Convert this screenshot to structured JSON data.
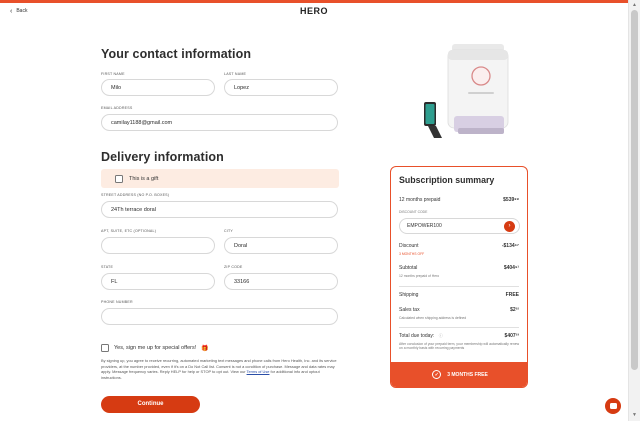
{
  "header": {
    "back_label": "Back",
    "logo": "HERO"
  },
  "contact": {
    "title": "Your contact information",
    "first_name_label": "FIRST NAME",
    "first_name_value": "Milo",
    "last_name_label": "LAST NAME",
    "last_name_value": "Lopez",
    "email_label": "EMAIL ADDRESS",
    "email_value": "camilay1188@gmail.com"
  },
  "delivery": {
    "title": "Delivery information",
    "gift_label": "This is a gift",
    "street_label": "STREET ADDRESS (NO P.O. BOXES)",
    "street_value": "24Th terrace doral",
    "apt_label": "APT, SUITE, ETC (OPTIONAL)",
    "apt_value": "",
    "city_label": "CITY",
    "city_value": "Doral",
    "state_label": "STATE",
    "state_value": "FL",
    "zip_label": "ZIP CODE",
    "zip_value": "33166",
    "phone_label": "PHONE NUMBER",
    "phone_value": ""
  },
  "offers_label": "Yes, sign me up for special offers!",
  "legal": {
    "text_before": "By signing up, you agree to receive recurring, automated marketing text messages and phone calls from Hero Health, Inc. and its service providers, at the number provided, even if it's on a Do Not Call list. Consent is not a condition of purchase. Message and data rates may apply. Message frequency varies. Reply HELP for help or STOP to opt out. View our ",
    "link": "Terms of Use",
    "text_after": " for additional info and optout instructions."
  },
  "continue_label": "Continue",
  "summary": {
    "title": "Subscription summary",
    "plan_label": "12 months prepaid",
    "plan_price": "$539⁸⁸",
    "discount_code_label": "DISCOUNT CODE",
    "discount_code_value": "EMPOWER100",
    "discount_label": "Discount",
    "discount_value": "-$134⁶⁷",
    "discount_note": "3 MONTHS OFF",
    "subtotal_label": "Subtotal",
    "subtotal_value": "$404⁹¹",
    "subtotal_note": "12 months prepaid of Hero",
    "shipping_label": "Shipping",
    "shipping_value": "FREE",
    "tax_label": "Sales tax",
    "tax_value": "$2³²",
    "tax_note": "Calculated when shipping address is defined",
    "total_label": "Total due today:",
    "total_value": "$407³³",
    "total_note": "After conclusion of your prepaid term, your membership will automatically renew on a monthly basis with recurring payments",
    "banner": "3 MONTHS FREE"
  },
  "colors": {
    "accent": "#e8502a",
    "button": "#d63b12",
    "gift_bg": "#fdece2"
  }
}
